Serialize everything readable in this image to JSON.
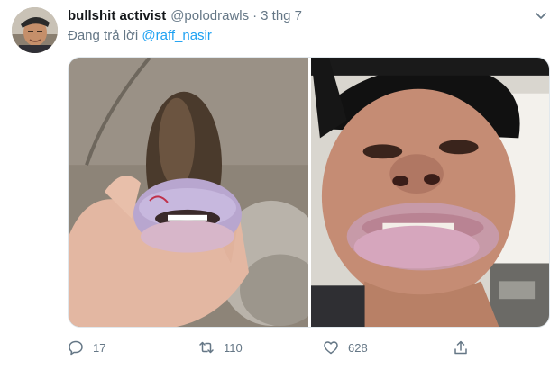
{
  "tweet": {
    "display_name": "bullshit activist",
    "handle": "@polodrawls",
    "separator": "·",
    "time": "3 thg 7",
    "reply_prefix": "Đang trả lời",
    "reply_to": "@raff_nasir",
    "more_icon": "chevron-down-icon"
  },
  "media": {
    "left_image": "fish-with-lips-photo",
    "right_image": "man-with-lips-selfie"
  },
  "actions": {
    "reply": {
      "icon": "reply-icon",
      "count": "17"
    },
    "retweet": {
      "icon": "retweet-icon",
      "count": "110"
    },
    "like": {
      "icon": "heart-icon",
      "count": "628"
    },
    "share": {
      "icon": "share-icon"
    }
  },
  "colors": {
    "link": "#1da1f2",
    "secondary_text": "#657786",
    "primary_text": "#14171a"
  }
}
